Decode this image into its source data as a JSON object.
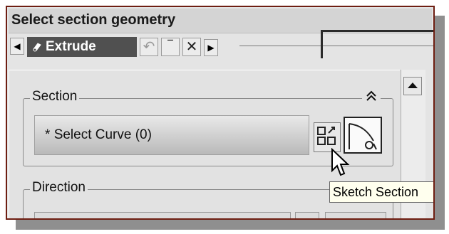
{
  "window": {
    "title": "Select section geometry"
  },
  "tabbar": {
    "active_tab_label": "Extrude",
    "prev_label": "◀",
    "next_label": "▶",
    "close_label": "✕",
    "minimize_label": "‾"
  },
  "section": {
    "legend": "Section",
    "collapse_label": "≈",
    "select_curve_label": "Select Curve (0)",
    "required_mark": "*"
  },
  "direction": {
    "legend": "Direction"
  },
  "tooltip": {
    "text": "Sketch Section"
  },
  "colors": {
    "frame_border": "#6e1e12",
    "tab_active_bg": "#505050",
    "tooltip_bg": "#ffffee"
  }
}
